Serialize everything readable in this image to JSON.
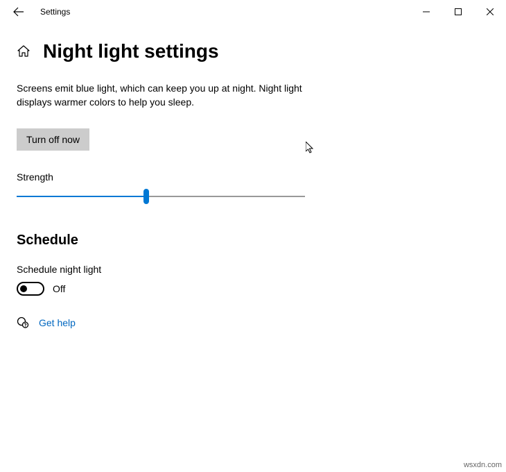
{
  "titlebar": {
    "app_name": "Settings"
  },
  "header": {
    "title": "Night light settings"
  },
  "description": "Screens emit blue light, which can keep you up at night. Night light displays warmer colors to help you sleep.",
  "button": {
    "turn_off": "Turn off now"
  },
  "slider": {
    "label": "Strength",
    "value": 45
  },
  "schedule": {
    "heading": "Schedule",
    "toggle_label": "Schedule night light",
    "toggle_state": "Off"
  },
  "help": {
    "link_text": "Get help"
  },
  "watermark": "wsxdn.com"
}
